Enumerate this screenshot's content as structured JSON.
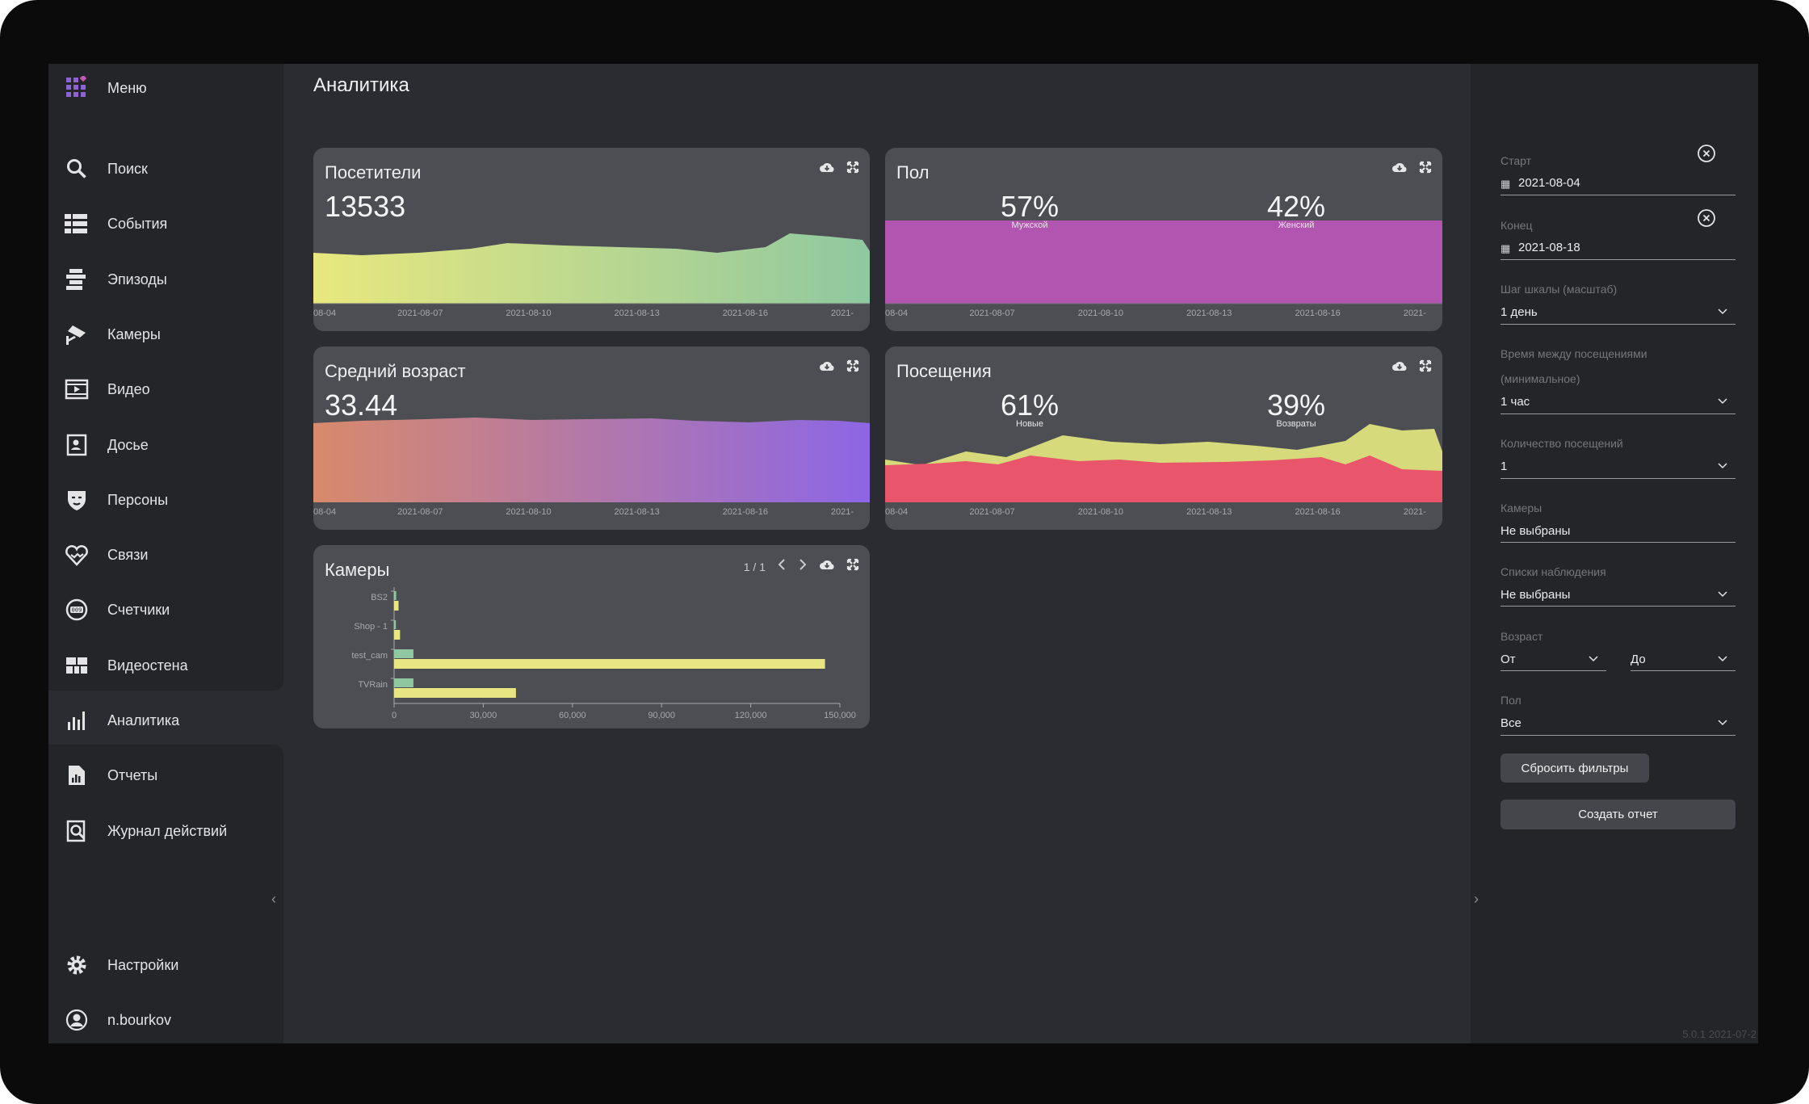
{
  "sidebar": {
    "menu_label": "Меню",
    "items": [
      {
        "label": "Поиск",
        "icon": "search-icon"
      },
      {
        "label": "События",
        "icon": "events-icon"
      },
      {
        "label": "Эпизоды",
        "icon": "episodes-icon"
      },
      {
        "label": "Камеры",
        "icon": "camera-icon"
      },
      {
        "label": "Видео",
        "icon": "video-icon"
      },
      {
        "label": "Досье",
        "icon": "dossier-icon"
      },
      {
        "label": "Персоны",
        "icon": "persons-icon"
      },
      {
        "label": "Связи",
        "icon": "relations-icon"
      },
      {
        "label": "Счетчики",
        "icon": "counters-icon"
      },
      {
        "label": "Видеостена",
        "icon": "videowall-icon"
      },
      {
        "label": "Аналитика",
        "icon": "analytics-icon"
      },
      {
        "label": "Отчеты",
        "icon": "reports-icon"
      },
      {
        "label": "Журнал действий",
        "icon": "audit-log-icon"
      }
    ],
    "active_item": "Аналитика",
    "settings_label": "Настройки",
    "user_label": "n.bourkov"
  },
  "page_title": "Аналитика",
  "cards": {
    "visitors": {
      "title": "Посетители",
      "value": "13533"
    },
    "gender": {
      "title": "Пол",
      "left_pct": "57%",
      "left_sub": "Мужской",
      "right_pct": "42%",
      "right_sub": "Женский"
    },
    "age": {
      "title": "Средний возраст",
      "value": "33.44"
    },
    "visits": {
      "title": "Посещения",
      "left_pct": "61%",
      "left_sub": "Новые",
      "right_pct": "39%",
      "right_sub": "Возвраты"
    },
    "cameras": {
      "title": "Камеры",
      "pager": "1 / 1"
    }
  },
  "x_ticks": [
    "08-04",
    "2021-08-07",
    "2021-08-10",
    "2021-08-13",
    "2021-08-16",
    "2021-"
  ],
  "colors": {
    "visitors_gradient": [
      "#e8e87e",
      "#8fc8a0"
    ],
    "gender": "#b255b0",
    "age_gradient": [
      "#d88a6c",
      "#8d66e6"
    ],
    "visits_new": "#d7da7a",
    "visits_return": "#e9556a",
    "cameras_green": "#8fc8a0",
    "cameras_yellow": "#e8e583"
  },
  "chart_data": {
    "type": "bar",
    "title": "Камеры",
    "categories": [
      "BS2",
      "Shop - 1",
      "test_cam",
      "TVRain"
    ],
    "series": [
      {
        "values": [
          700,
          600,
          6500,
          6500
        ]
      },
      {
        "values": [
          1500,
          2000,
          145000,
          41000
        ]
      }
    ],
    "x_ticks": [
      "0",
      "30,000",
      "60,000",
      "90,000",
      "120,000",
      "150,000"
    ],
    "xlim": [
      0,
      150000
    ]
  },
  "filters": {
    "start": {
      "label": "Старт",
      "value": "2021-08-04"
    },
    "end": {
      "label": "Конец",
      "value": "2021-08-18"
    },
    "scale": {
      "label": "Шаг шкалы (масштаб)",
      "value": "1 день"
    },
    "time_between": {
      "label": "Время между посещениями",
      "label2": "(минимальное)",
      "value": "1 час"
    },
    "visits_count": {
      "label": "Количество посещений",
      "value": "1"
    },
    "cameras": {
      "label": "Камеры",
      "value": "Не выбраны"
    },
    "watchlists": {
      "label": "Списки наблюдения",
      "value": "Не выбраны"
    },
    "age": {
      "label": "Возраст",
      "from": "От",
      "to": "До"
    },
    "gender": {
      "label": "Пол",
      "value": "Все"
    },
    "reset_label": "Сбросить фильтры",
    "create_label": "Создать отчет"
  },
  "version": "5.0.1 2021-07-2"
}
